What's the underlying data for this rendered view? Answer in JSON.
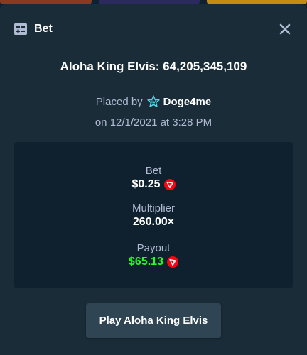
{
  "header": {
    "title": "Bet",
    "icon": "bet-slip-icon",
    "close_icon": "close-icon"
  },
  "game_line": "Aloha King Elvis: 64,205,345,109",
  "placed": {
    "prefix": "Placed by",
    "user_icon": "vip-star-icon",
    "username": "Doge4me",
    "date_line": "on 12/1/2021 at 3:28 PM"
  },
  "details": {
    "bet_label": "Bet",
    "bet_value": "$0.25",
    "multiplier_label": "Multiplier",
    "multiplier_value": "260.00×",
    "payout_label": "Payout",
    "payout_value": "$65.13",
    "currency_icon": "tron-coin-icon"
  },
  "play_button": "Play Aloha King Elvis",
  "colors": {
    "background": "#0f212e",
    "modal": "#1a2c38",
    "muted_text": "#b1bad3",
    "payout_green": "#1fff20",
    "coin_red": "#ff0013",
    "vip_cyan": "#4fd8e6",
    "button": "#2f4553"
  }
}
